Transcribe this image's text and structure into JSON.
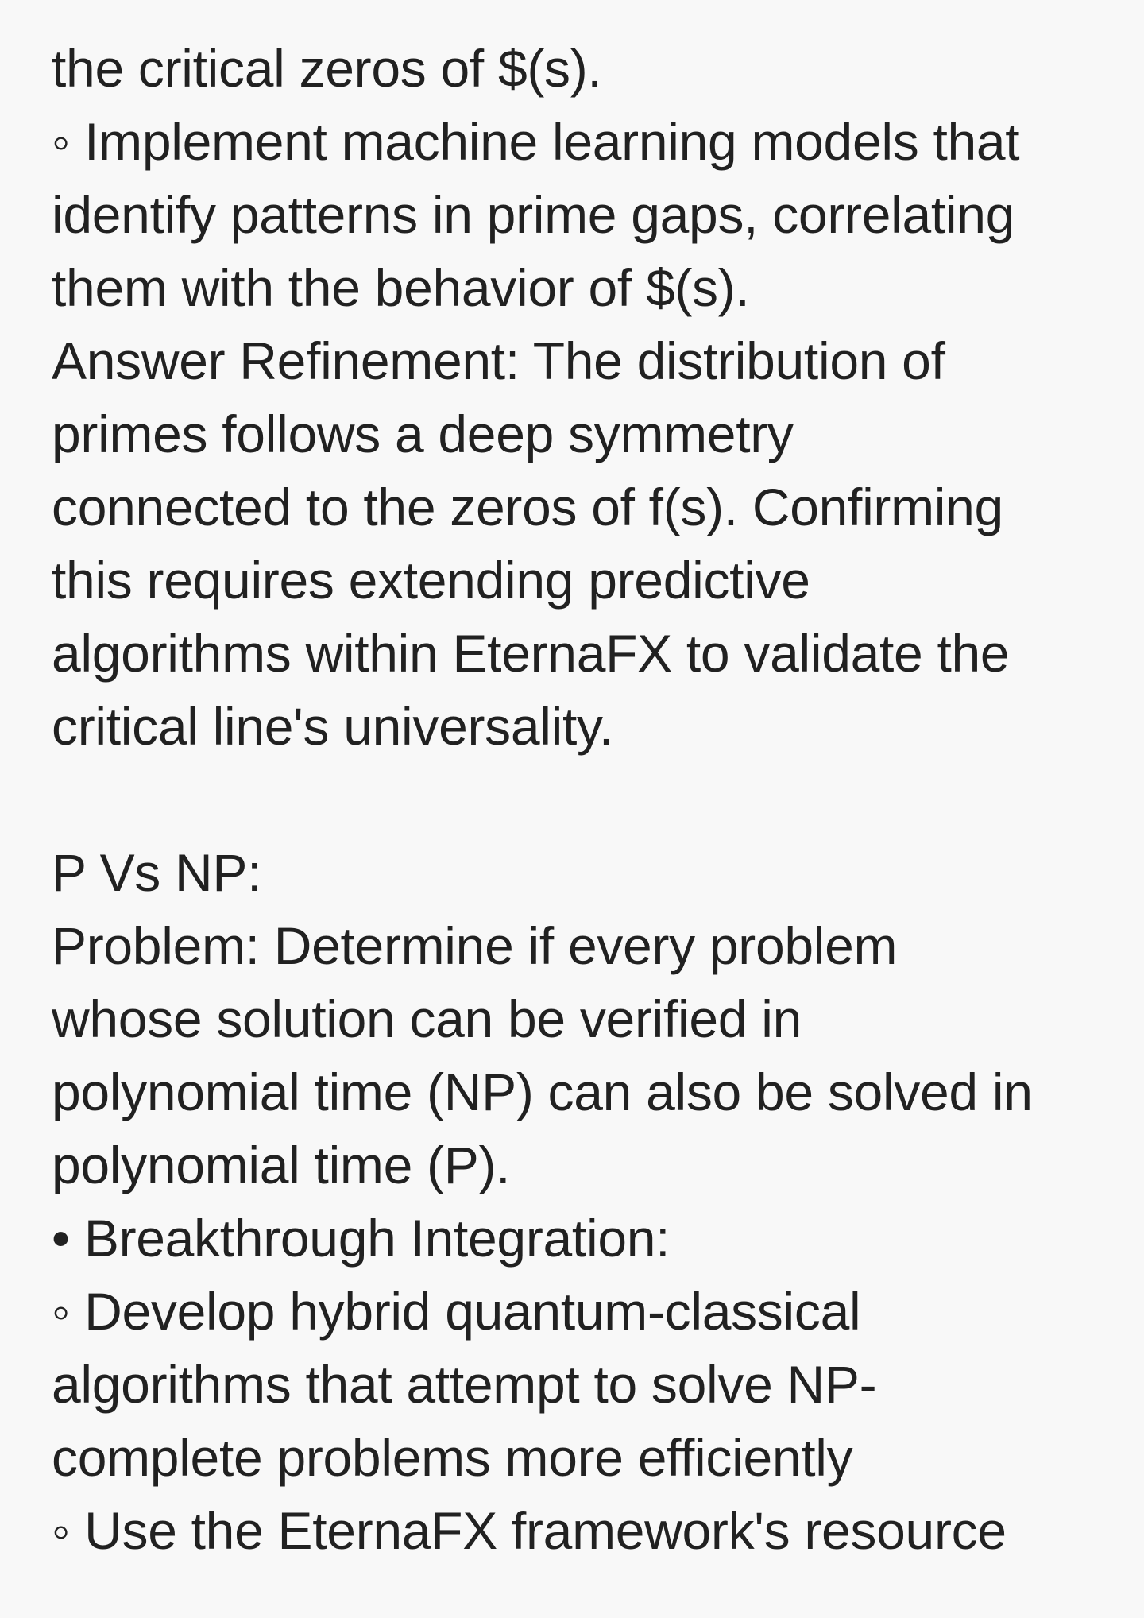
{
  "lines": [
    "the critical zeros of $(s).",
    "◦ Implement machine learning models that",
    "identify patterns in prime gaps, correlating",
    "them with the behavior of $(s).",
    "Answer Refinement: The distribution of",
    "primes follows a deep symmetry",
    "connected to the zeros of f(s). Confirming",
    "this requires extending predictive",
    "algorithms within EternaFX to validate the",
    "critical line's universality.",
    "",
    "P Vs NP:",
    "Problem: Determine if every problem",
    "whose solution can be verified in",
    "polynomial time (NP) can also be solved in",
    "polynomial time (P).",
    "• Breakthrough Integration:",
    "◦ Develop hybrid quantum-classical",
    "algorithms that attempt to solve NP-",
    "complete problems more efficiently",
    "◦ Use the EternaFX framework's resource"
  ]
}
